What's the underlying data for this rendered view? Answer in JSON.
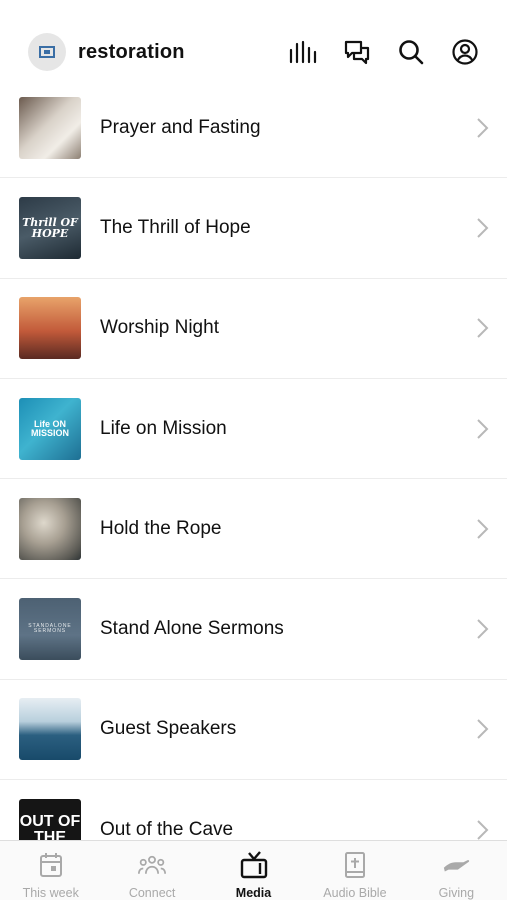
{
  "header": {
    "org_name": "restoration",
    "icons": [
      "audio-bars-icon",
      "chat-bubbles-icon",
      "search-icon",
      "profile-icon"
    ]
  },
  "media": {
    "items": [
      {
        "title": "Prayer and Fasting",
        "thumb_text": ""
      },
      {
        "title": "The Thrill of Hope",
        "thumb_text": "Thrill OF HOPE"
      },
      {
        "title": "Worship Night",
        "thumb_text": ""
      },
      {
        "title": "Life on Mission",
        "thumb_text": "Life ON MISSION"
      },
      {
        "title": "Hold the Rope",
        "thumb_text": ""
      },
      {
        "title": "Stand Alone Sermons",
        "thumb_text": "STANDALONE SERMONS"
      },
      {
        "title": "Guest Speakers",
        "thumb_text": ""
      },
      {
        "title": "Out of the Cave",
        "thumb_text": "OUT OF THE"
      }
    ]
  },
  "tabs": [
    {
      "label": "This week",
      "icon": "calendar-icon",
      "active": false
    },
    {
      "label": "Connect",
      "icon": "group-icon",
      "active": false
    },
    {
      "label": "Media",
      "icon": "tv-icon",
      "active": true
    },
    {
      "label": "Audio Bible",
      "icon": "bible-icon",
      "active": false
    },
    {
      "label": "Giving",
      "icon": "giving-hand-icon",
      "active": false
    }
  ],
  "colors": {
    "active_tab": "#111111",
    "inactive_tab": "#a9a9a9",
    "divider": "#ececec"
  }
}
